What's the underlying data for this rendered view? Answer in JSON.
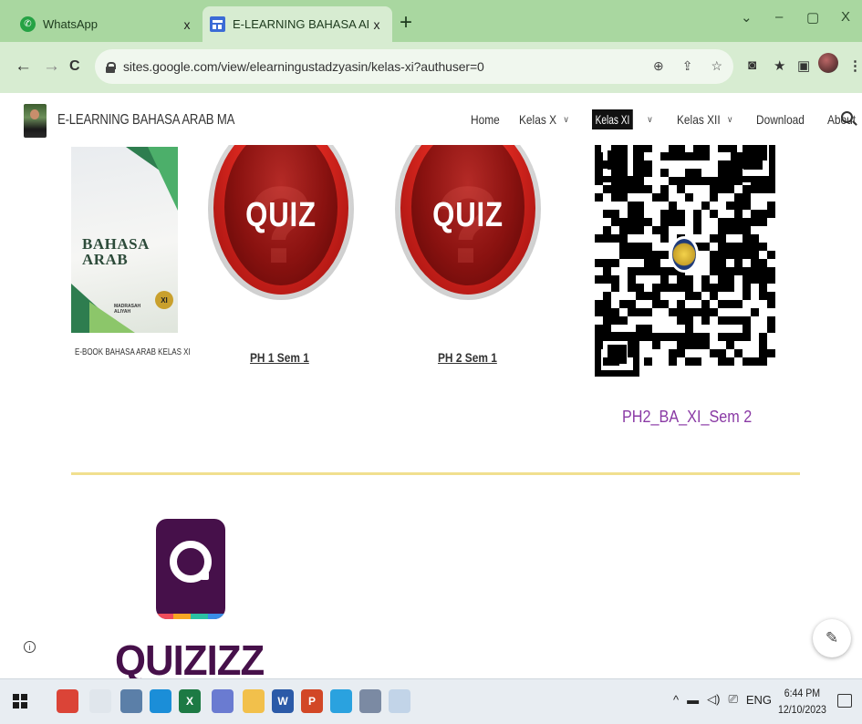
{
  "browser": {
    "tabs": [
      {
        "title": "WhatsApp",
        "icon": "whatsapp-icon",
        "active": false
      },
      {
        "title": "E-LEARNING BAHASA ARAB MA",
        "icon": "google-sites-icon",
        "active": true
      }
    ],
    "tab_close": "x",
    "new_tab": "+",
    "window_controls": {
      "tab_search": "⌄",
      "minimize": "–",
      "maximize": "▢",
      "close": "X"
    },
    "nav": {
      "back": "←",
      "forward": "→",
      "reload": "C"
    },
    "url": "sites.google.com/view/elearningustadzyasin/kelas-xi?authuser=0",
    "omnibox_icons": [
      "zoom-icon",
      "share-icon",
      "bookmark-star-icon"
    ],
    "extensions": [
      "extension-icon",
      "puzzle-icon",
      "sidepanel-icon",
      "profile-avatar"
    ]
  },
  "site": {
    "title": "E-LEARNING BAHASA ARAB MA",
    "nav": [
      {
        "label": "Home",
        "dropdown": false,
        "active": false
      },
      {
        "label": "Kelas X",
        "dropdown": true,
        "active": false
      },
      {
        "label": "Kelas XI",
        "dropdown": true,
        "active": true
      },
      {
        "label": "Kelas XII",
        "dropdown": true,
        "active": false
      },
      {
        "label": "Download",
        "dropdown": false,
        "active": false
      },
      {
        "label": "About",
        "dropdown": false,
        "active": false
      }
    ],
    "chevron": "v"
  },
  "content": {
    "book": {
      "cover_title_line1": "BAHASA",
      "cover_title_line2": "ARAB",
      "cover_publisher_line1": "MADRASAH",
      "cover_publisher_line2": "ALIYAH",
      "cover_grade": "XI",
      "caption": "E-BOOK BAHASA ARAB KELAS XI"
    },
    "quizzes": [
      {
        "button_text": "QUIZ",
        "link": "PH 1 Sem 1"
      },
      {
        "button_text": "QUIZ",
        "link": "PH 2 Sem 1"
      }
    ],
    "qr_caption": "PH2_BA_XI_Sem 2",
    "quizizz_word": "QUIZIZZ",
    "info": "i",
    "edit": "✎"
  },
  "taskbar": {
    "apps": [
      {
        "name": "chrome-icon",
        "color": "#db4437",
        "label": ""
      },
      {
        "name": "snipping-tool-icon",
        "color": "#e0e6ec",
        "label": ""
      },
      {
        "name": "notes-icon",
        "color": "#5b7fa8",
        "label": ""
      },
      {
        "name": "edge-icon",
        "color": "#1b8ed8",
        "label": ""
      },
      {
        "name": "excel-icon",
        "color": "#1d7a44",
        "label": "X"
      },
      {
        "name": "file-icon",
        "color": "#6a7bd1",
        "label": ""
      },
      {
        "name": "file-explorer-icon",
        "color": "#f2c04b",
        "label": ""
      },
      {
        "name": "word-icon",
        "color": "#2b5aa8",
        "label": "W"
      },
      {
        "name": "powerpoint-icon",
        "color": "#d24726",
        "label": "P"
      },
      {
        "name": "telegram-icon",
        "color": "#2aa2df",
        "label": ""
      },
      {
        "name": "app-icon",
        "color": "#7b8aa3",
        "label": ""
      },
      {
        "name": "paint-icon",
        "color": "#c2d4e8",
        "label": ""
      }
    ],
    "tray": {
      "chevron": "^",
      "language": "ENG"
    },
    "time": "6:44 PM",
    "date": "12/10/2023"
  }
}
